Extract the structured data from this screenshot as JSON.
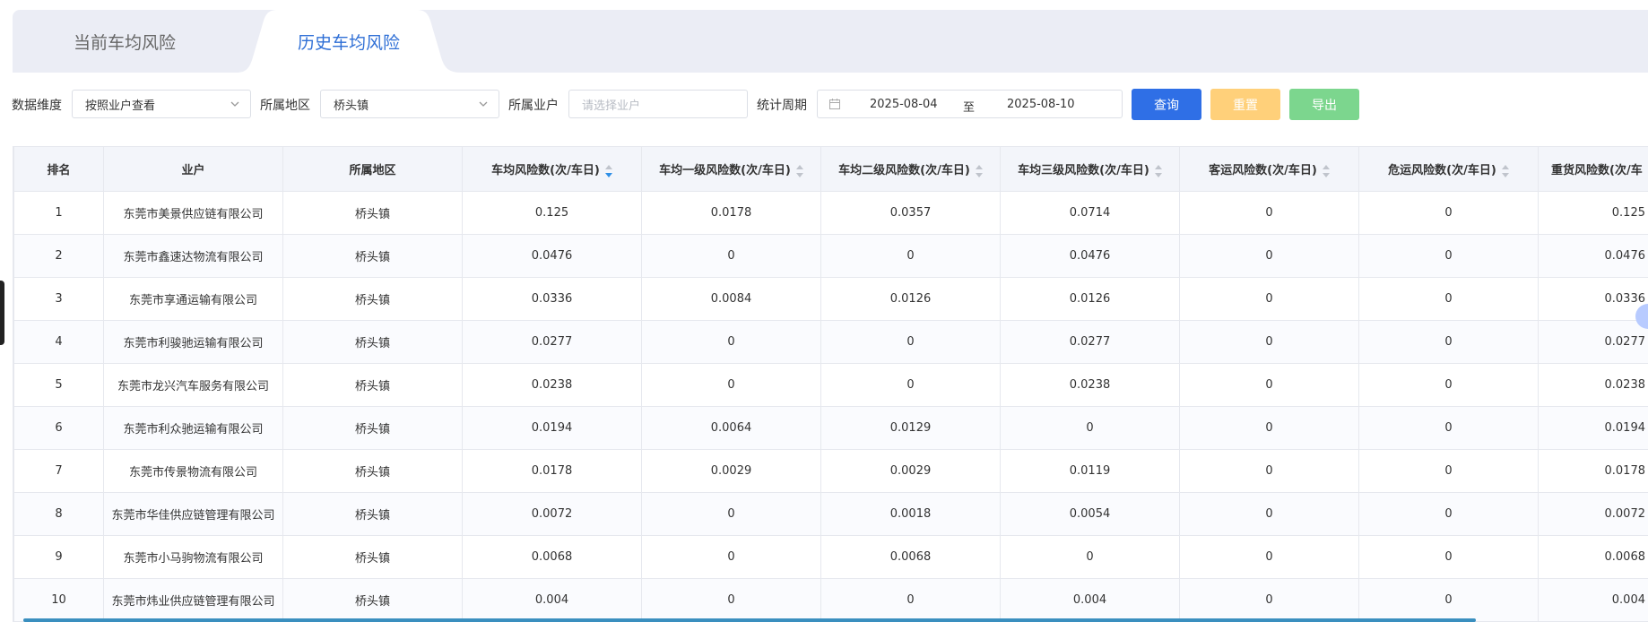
{
  "tabs": [
    {
      "label": "当前车均风险"
    },
    {
      "label": "历史车均风险"
    }
  ],
  "filters": {
    "dimension_label": "数据维度",
    "dimension_value": "按照业户查看",
    "region_label": "所属地区",
    "region_value": "桥头镇",
    "owner_label": "所属业户",
    "owner_placeholder": "请选择业户",
    "period_label": "统计周期",
    "date_start": "2025-08-04",
    "date_sep": "至",
    "date_end": "2025-08-10"
  },
  "buttons": {
    "query": "查询",
    "reset": "重置",
    "export": "导出"
  },
  "table": {
    "columns": [
      "排名",
      "业户",
      "所属地区",
      "车均风险数(次/车日)",
      "车均一级风险数(次/车日)",
      "车均二级风险数(次/车日)",
      "车均三级风险数(次/车日)",
      "客运风险数(次/车日)",
      "危运风险数(次/车日)",
      "重货风险数(次/车"
    ],
    "rows": [
      [
        "1",
        "东莞市美景供应链有限公司",
        "桥头镇",
        "0.125",
        "0.0178",
        "0.0357",
        "0.0714",
        "0",
        "0",
        "0.125"
      ],
      [
        "2",
        "东莞市鑫速达物流有限公司",
        "桥头镇",
        "0.0476",
        "0",
        "0",
        "0.0476",
        "0",
        "0",
        "0.0476"
      ],
      [
        "3",
        "东莞市享通运输有限公司",
        "桥头镇",
        "0.0336",
        "0.0084",
        "0.0126",
        "0.0126",
        "0",
        "0",
        "0.0336"
      ],
      [
        "4",
        "东莞市利骏驰运输有限公司",
        "桥头镇",
        "0.0277",
        "0",
        "0",
        "0.0277",
        "0",
        "0",
        "0.0277"
      ],
      [
        "5",
        "东莞市龙兴汽车服务有限公司",
        "桥头镇",
        "0.0238",
        "0",
        "0",
        "0.0238",
        "0",
        "0",
        "0.0238"
      ],
      [
        "6",
        "东莞市利众驰运输有限公司",
        "桥头镇",
        "0.0194",
        "0.0064",
        "0.0129",
        "0",
        "0",
        "0",
        "0.0194"
      ],
      [
        "7",
        "东莞市传景物流有限公司",
        "桥头镇",
        "0.0178",
        "0.0029",
        "0.0029",
        "0.0119",
        "0",
        "0",
        "0.0178"
      ],
      [
        "8",
        "东莞市华佳供应链管理有限公司",
        "桥头镇",
        "0.0072",
        "0",
        "0.0018",
        "0.0054",
        "0",
        "0",
        "0.0072"
      ],
      [
        "9",
        "东莞市小马驹物流有限公司",
        "桥头镇",
        "0.0068",
        "0",
        "0.0068",
        "0",
        "0",
        "0",
        "0.0068"
      ],
      [
        "10",
        "东莞市炜业供应链管理有限公司",
        "桥头镇",
        "0.004",
        "0",
        "0",
        "0.004",
        "0",
        "0",
        "0.004"
      ]
    ]
  },
  "colors": {
    "accent": "#2f6fe6",
    "reset": "#ffd07a",
    "export": "#7cd68e",
    "tab_bg": "#ebedf5",
    "header_bg": "#f3f5fa"
  }
}
